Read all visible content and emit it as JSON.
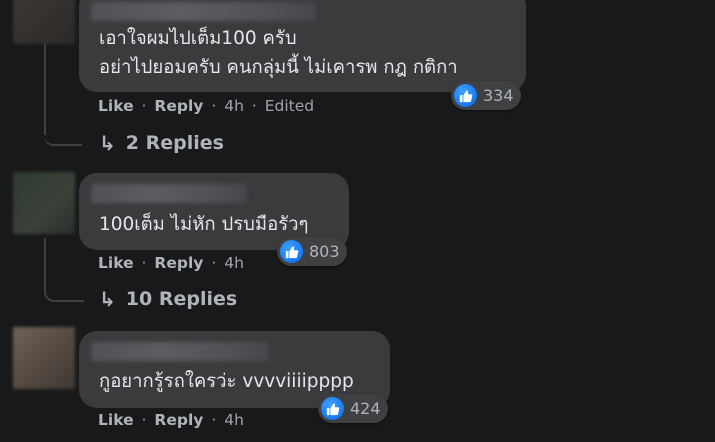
{
  "comments": [
    {
      "lines": [
        "เอาใจผมไปเต็ม100 ครับ",
        "อย่าไปยอมครับ คนกลุ่มนี้ ไม่เคารพ กฎ กติกา"
      ],
      "like_label": "Like",
      "reply_label": "Reply",
      "time": "4h",
      "edited": "Edited",
      "reaction_count": "334",
      "replies_label": "2 Replies"
    },
    {
      "lines": [
        "100เต็ม ไม่หัก ปรบมือรัวๆ"
      ],
      "like_label": "Like",
      "reply_label": "Reply",
      "time": "4h",
      "reaction_count": "803",
      "replies_label": "10 Replies"
    },
    {
      "lines": [
        "กูอยากรู้รถใครว่ะ vvvviiiipppp"
      ],
      "like_label": "Like",
      "reply_label": "Reply",
      "time": "4h",
      "reaction_count": "424"
    }
  ],
  "separator": "·",
  "icons": {
    "reaction": "thumbs-up-icon",
    "reply_arrow": "reply-arrow-icon"
  },
  "colors": {
    "background": "#18191a",
    "bubble": "#3a3b3c",
    "like_blue": "#1877f2",
    "muted_text": "#b0b3b8"
  }
}
